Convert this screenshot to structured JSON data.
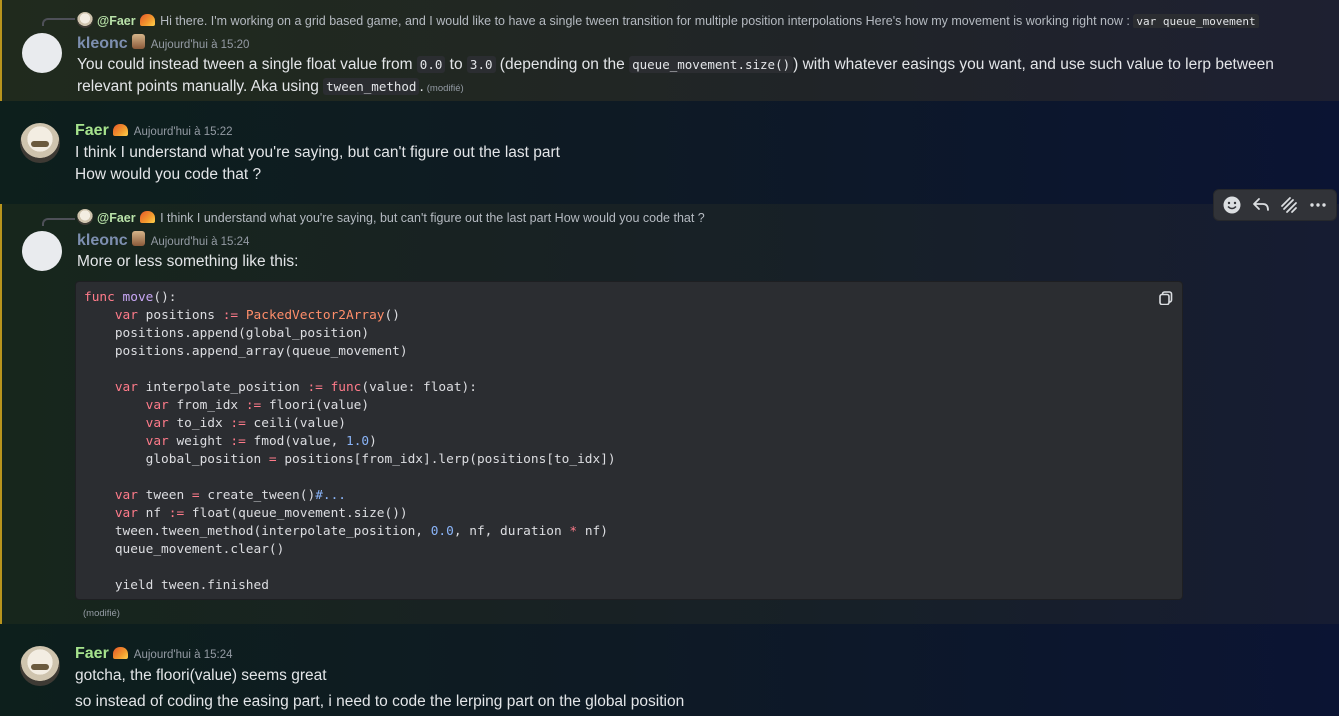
{
  "messages": [
    {
      "reply": {
        "author": "@Faer",
        "text": "Hi there. I'm working on a grid based game, and I would like to have a single tween transition for multiple position interpolations Here's how my movement is working right now :",
        "code": "var queue_movement"
      },
      "author": "kleonc",
      "timestamp": "Aujourd'hui à 15:20",
      "body": {
        "t1": "You could instead tween a single float value from ",
        "c1": "0.0",
        "t2": " to ",
        "c2": "3.0",
        "t3": " (depending on the ",
        "c3": "queue_movement.size()",
        "t4": ") with whatever easings you want, and use such value to lerp between",
        "t5": "relevant points manually. Aka using ",
        "c4": "tween_method",
        "t6": ".",
        "edited": "(modifié)"
      }
    },
    {
      "author": "Faer",
      "timestamp": "Aujourd'hui à 15:22",
      "lines": [
        "I think I understand what you're saying, but can't figure out the last part",
        "How would you code that ?"
      ]
    },
    {
      "reply": {
        "author": "@Faer",
        "text": "I think I understand what you're saying, but can't figure out the last part How would you code that ?"
      },
      "author": "kleonc",
      "timestamp": "Aujourd'hui à 15:24",
      "intro": "More or less something like this:",
      "edited": "(modifié)"
    },
    {
      "author": "Faer",
      "timestamp": "Aujourd'hui à 15:24",
      "lines": [
        "gotcha, the floori(value) seems great",
        "so instead of coding the easing part, i need to code the lerping part on the global position"
      ]
    }
  ],
  "code_lines": [
    [
      [
        "k",
        "func "
      ],
      [
        "f",
        "move"
      ],
      [
        "p",
        "():"
      ]
    ],
    [
      [
        "p",
        "    "
      ],
      [
        "k",
        "var "
      ],
      [
        "p",
        "positions "
      ],
      [
        "k",
        ":= "
      ],
      [
        "t",
        "PackedVector2Array"
      ],
      [
        "p",
        "()"
      ]
    ],
    [
      [
        "p",
        "    positions.append(global_position)"
      ]
    ],
    [
      [
        "p",
        "    positions.append_array(queue_movement)"
      ]
    ],
    [],
    [
      [
        "p",
        "    "
      ],
      [
        "k",
        "var "
      ],
      [
        "p",
        "interpolate_position "
      ],
      [
        "k",
        ":= func"
      ],
      [
        "p",
        "(value: float):"
      ]
    ],
    [
      [
        "p",
        "        "
      ],
      [
        "k",
        "var "
      ],
      [
        "p",
        "from_idx "
      ],
      [
        "k",
        ":= "
      ],
      [
        "p",
        "floori(value)"
      ]
    ],
    [
      [
        "p",
        "        "
      ],
      [
        "k",
        "var "
      ],
      [
        "p",
        "to_idx "
      ],
      [
        "k",
        ":= "
      ],
      [
        "p",
        "ceili(value)"
      ]
    ],
    [
      [
        "p",
        "        "
      ],
      [
        "k",
        "var "
      ],
      [
        "p",
        "weight "
      ],
      [
        "k",
        ":= "
      ],
      [
        "p",
        "fmod(value, "
      ],
      [
        "n",
        "1.0"
      ],
      [
        "p",
        ")"
      ]
    ],
    [
      [
        "p",
        "        global_position "
      ],
      [
        "k",
        "= "
      ],
      [
        "p",
        "positions[from_idx].lerp(positions[to_idx])"
      ]
    ],
    [],
    [
      [
        "p",
        "    "
      ],
      [
        "k",
        "var "
      ],
      [
        "p",
        "tween "
      ],
      [
        "k",
        "= "
      ],
      [
        "p",
        "create_tween()"
      ],
      [
        "cm",
        "#..."
      ]
    ],
    [
      [
        "p",
        "    "
      ],
      [
        "k",
        "var "
      ],
      [
        "p",
        "nf "
      ],
      [
        "k",
        ":= "
      ],
      [
        "p",
        "float(queue_movement.size())"
      ]
    ],
    [
      [
        "p",
        "    tween.tween_method(interpolate_position, "
      ],
      [
        "n",
        "0.0"
      ],
      [
        "p",
        ", nf, duration "
      ],
      [
        "k",
        "* "
      ],
      [
        "p",
        "nf)"
      ]
    ],
    [
      [
        "p",
        "    queue_movement.clear()"
      ]
    ],
    [],
    [
      [
        "p",
        "    yield tween.finished"
      ]
    ]
  ],
  "icons": {
    "reaction": "smiley-icon",
    "reply": "reply-icon",
    "forward": "forward-icon",
    "more": "more-icon",
    "copy": "copy-icon",
    "role_badge": "pizza-badge-icon",
    "role_badge_2": "cat-badge-icon"
  },
  "colors": {
    "highlight_border": "#b8941d",
    "faer_name": "#a6e38d",
    "kleonc_name": "#7d8fb0",
    "keyword": "#ff7b8a",
    "function": "#c8a7f5",
    "type": "#ff8e6a",
    "number": "#8ab4f8"
  }
}
